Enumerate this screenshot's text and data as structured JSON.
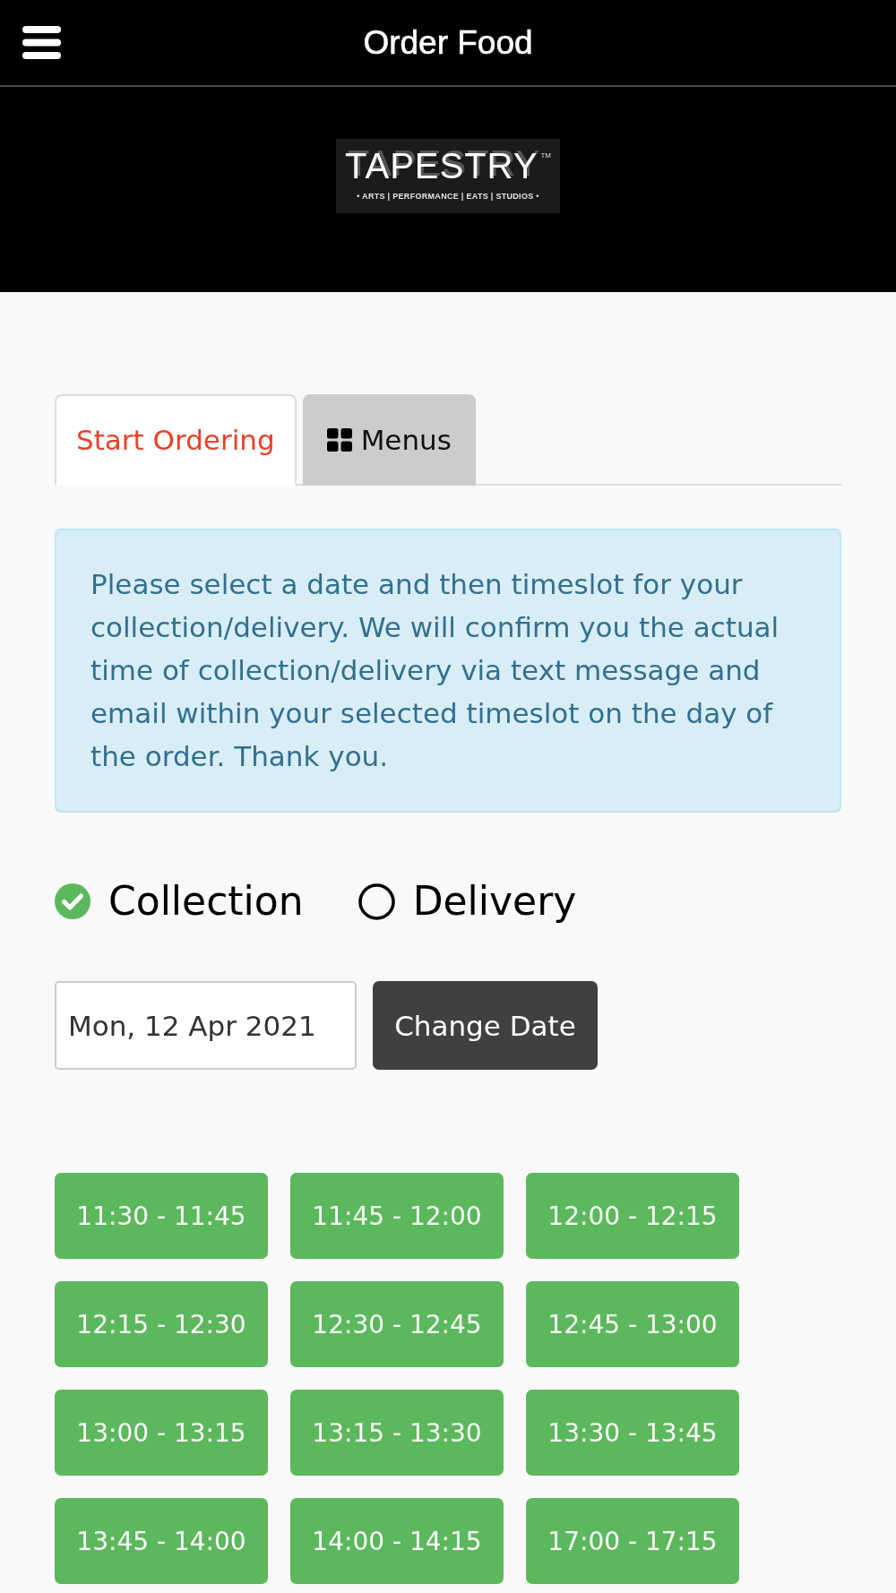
{
  "header": {
    "title": "Order Food"
  },
  "logo": {
    "wordmark": "TAPESTRY",
    "trademark": "TM",
    "tagline": "• ARTS | PERFORMANCE | EATS | STUDIOS •"
  },
  "tabs": [
    {
      "label": "Start Ordering",
      "selected": true,
      "kind": "plain"
    },
    {
      "label": "Menus",
      "selected": false,
      "kind": "grid"
    }
  ],
  "notice": "Please select a date and then timeslot for your collection/delivery. We will confirm you the actual time of collection/delivery via text message and email within your selected timeslot on the day of the order. Thank you.",
  "fulfilment": [
    {
      "label": "Collection",
      "selected": true
    },
    {
      "label": "Delivery",
      "selected": false
    }
  ],
  "date_field": {
    "value": "Mon, 12 Apr 2021"
  },
  "change_date_button": "Change Date",
  "timeslots": [
    "11:30 - 11:45",
    "11:45 - 12:00",
    "12:00 - 12:15",
    "12:15 - 12:30",
    "12:30 - 12:45",
    "12:45 - 13:00",
    "13:00 - 13:15",
    "13:15 - 13:30",
    "13:30 - 13:45",
    "13:45 - 14:00",
    "14:00 - 14:15",
    "17:00 - 17:15"
  ]
}
